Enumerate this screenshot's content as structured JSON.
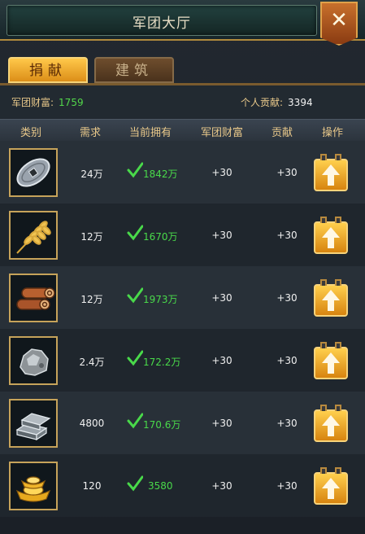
{
  "header": {
    "title": "军团大厅",
    "close_label": "✕"
  },
  "tabs": [
    {
      "label": "捐献",
      "active": true
    },
    {
      "label": "建筑",
      "active": false
    }
  ],
  "info": {
    "wealth_label": "军团财富:",
    "wealth_value": "1759",
    "contribution_label": "个人贡献:",
    "contribution_value": "3394"
  },
  "columns": [
    "类别",
    "需求",
    "当前拥有",
    "军团财富",
    "贡献",
    "操作"
  ],
  "rows": [
    {
      "icon": "coin-icon",
      "required": "24万",
      "owned": "1842万",
      "wealth": "+30",
      "contribution": "+30"
    },
    {
      "icon": "wheat-icon",
      "required": "12万",
      "owned": "1670万",
      "wealth": "+30",
      "contribution": "+30"
    },
    {
      "icon": "wood-icon",
      "required": "12万",
      "owned": "1973万",
      "wealth": "+30",
      "contribution": "+30"
    },
    {
      "icon": "ore-icon",
      "required": "2.4万",
      "owned": "172.2万",
      "wealth": "+30",
      "contribution": "+30"
    },
    {
      "icon": "ingot-icon",
      "required": "4800",
      "owned": "170.6万",
      "wealth": "+30",
      "contribution": "+30"
    },
    {
      "icon": "gold-ingot-icon",
      "required": "120",
      "owned": "3580",
      "wealth": "+30",
      "contribution": "+30"
    }
  ],
  "colors": {
    "accent": "#f0a522",
    "owned_green": "#49d94a",
    "label_gold": "#e8c88a"
  }
}
